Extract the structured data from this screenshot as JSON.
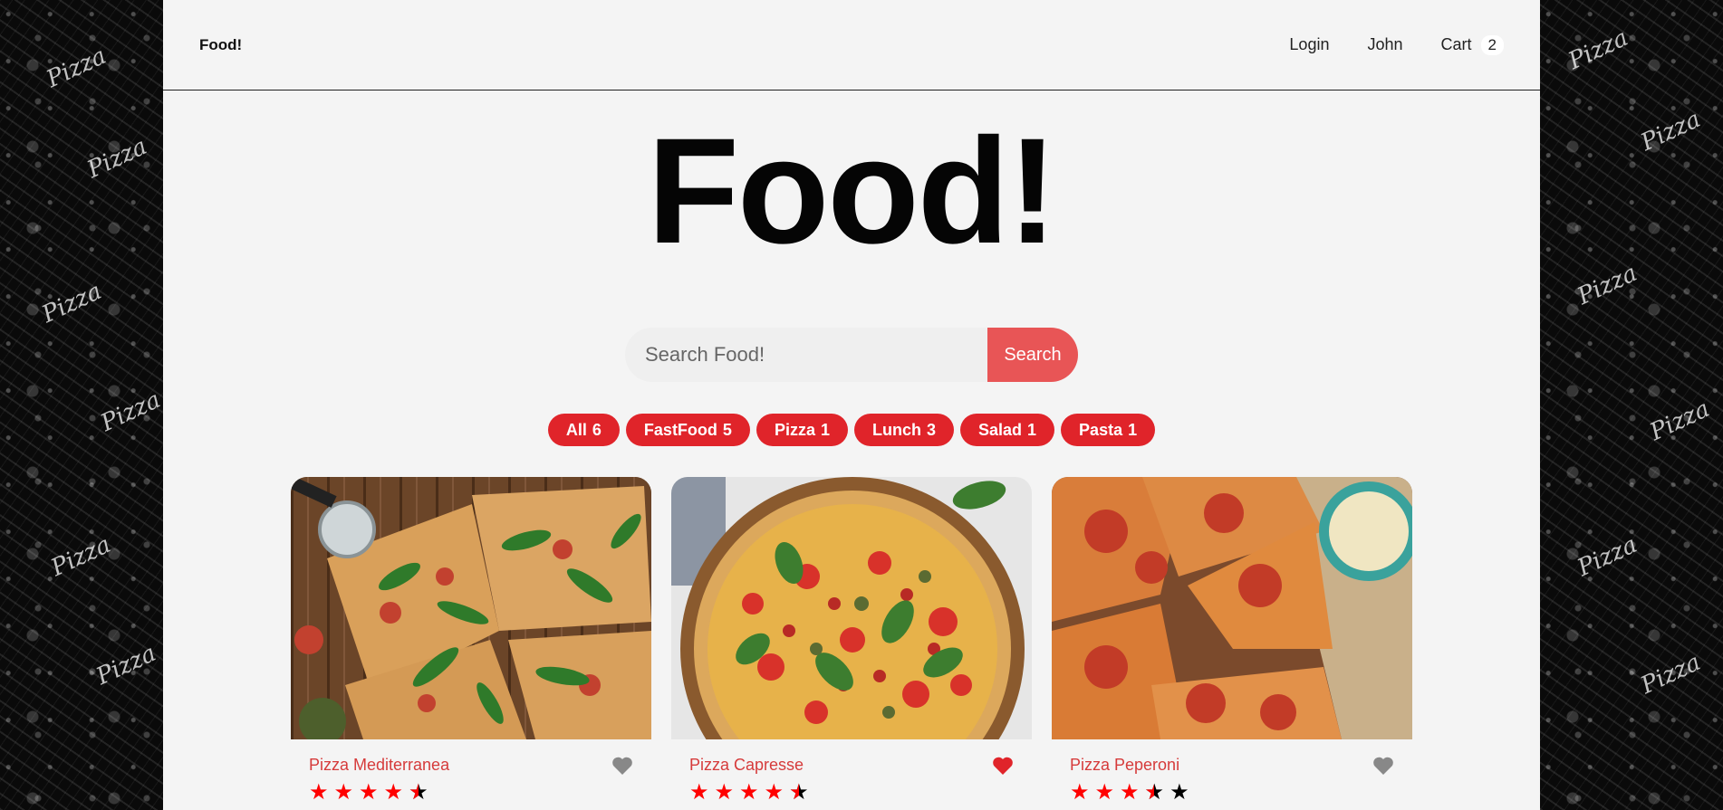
{
  "brand": "Food!",
  "nav": {
    "login": "Login",
    "user": "John",
    "cart_label": "Cart",
    "cart_count": "2"
  },
  "hero_title": "Food!",
  "search": {
    "placeholder": "Search Food!",
    "button": "Search"
  },
  "tags": [
    {
      "name": "All",
      "count": "6"
    },
    {
      "name": "FastFood",
      "count": "5"
    },
    {
      "name": "Pizza",
      "count": "1"
    },
    {
      "name": "Lunch",
      "count": "3"
    },
    {
      "name": "Salad",
      "count": "1"
    },
    {
      "name": "Pasta",
      "count": "1"
    }
  ],
  "foods": [
    {
      "name": "Pizza Mediterranea",
      "rating": 4.5,
      "favorite": false
    },
    {
      "name": "Pizza Capresse",
      "rating": 4.5,
      "favorite": true
    },
    {
      "name": "Pizza Peperoni",
      "rating": 3.5,
      "favorite": false
    }
  ],
  "pattern_word": "Pizza",
  "colors": {
    "accent": "#e0242a",
    "search_button": "#e85556",
    "food_name": "#d63b3b",
    "heart_on": "#e0242a",
    "heart_off": "#888888"
  },
  "icons": {
    "favorite": "heart-icon",
    "rating": "star-icon"
  }
}
